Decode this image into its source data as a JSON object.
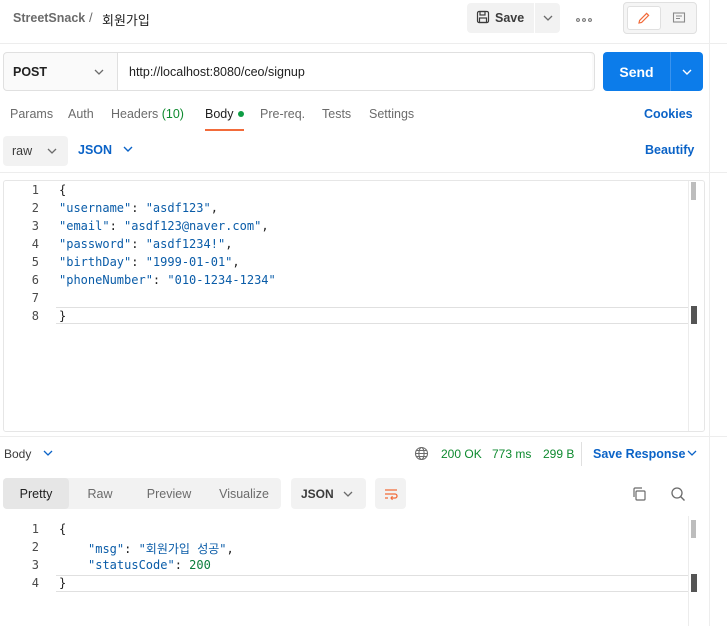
{
  "header": {
    "collection": "StreetSnack",
    "separator": "/",
    "request_name": "회원가입",
    "save_label": "Save",
    "more_label": "ooo"
  },
  "request": {
    "method": "POST",
    "url": "http://localhost:8080/ceo/signup",
    "send_label": "Send"
  },
  "request_tabs": {
    "params": "Params",
    "auth": "Auth",
    "headers": "Headers",
    "headers_count": "(10)",
    "body": "Body",
    "prereq": "Pre-req.",
    "tests": "Tests",
    "settings": "Settings",
    "cookies": "Cookies"
  },
  "body_toolbar": {
    "mode": "raw",
    "language": "JSON",
    "beautify": "Beautify"
  },
  "request_body": {
    "line_numbers": [
      "1",
      "2",
      "3",
      "4",
      "5",
      "6",
      "7",
      "8"
    ],
    "open_brace": "{",
    "close_brace": "}",
    "fields": [
      {
        "key": "\"username\"",
        "value": "\"asdf123\""
      },
      {
        "key": "\"email\"",
        "value": "\"asdf123@naver.com\""
      },
      {
        "key": "\"password\"",
        "value": "\"asdf1234!\""
      },
      {
        "key": "\"birthDay\"",
        "value": "\"1999-01-01\""
      },
      {
        "key": "\"phoneNumber\"",
        "value": "\"010-1234-1234\""
      }
    ]
  },
  "response": {
    "section_label": "Body",
    "status": "200 OK",
    "time": "773 ms",
    "size": "299 B",
    "save_response": "Save Response",
    "tabs": {
      "pretty": "Pretty",
      "raw": "Raw",
      "preview": "Preview",
      "visualize": "Visualize"
    },
    "format": "JSON",
    "line_numbers": [
      "1",
      "2",
      "3",
      "4"
    ],
    "open_brace": "{",
    "close_brace": "}",
    "fields": [
      {
        "key": "\"msg\"",
        "value": "\"회원가입 성공\""
      },
      {
        "key": "\"statusCode\"",
        "value": "200"
      }
    ]
  },
  "colors": {
    "accent_blue": "#0c7cea",
    "link_blue": "#0b63c7",
    "status_green": "#0e8a2f",
    "active_tab_underline": "#f26b3a"
  }
}
